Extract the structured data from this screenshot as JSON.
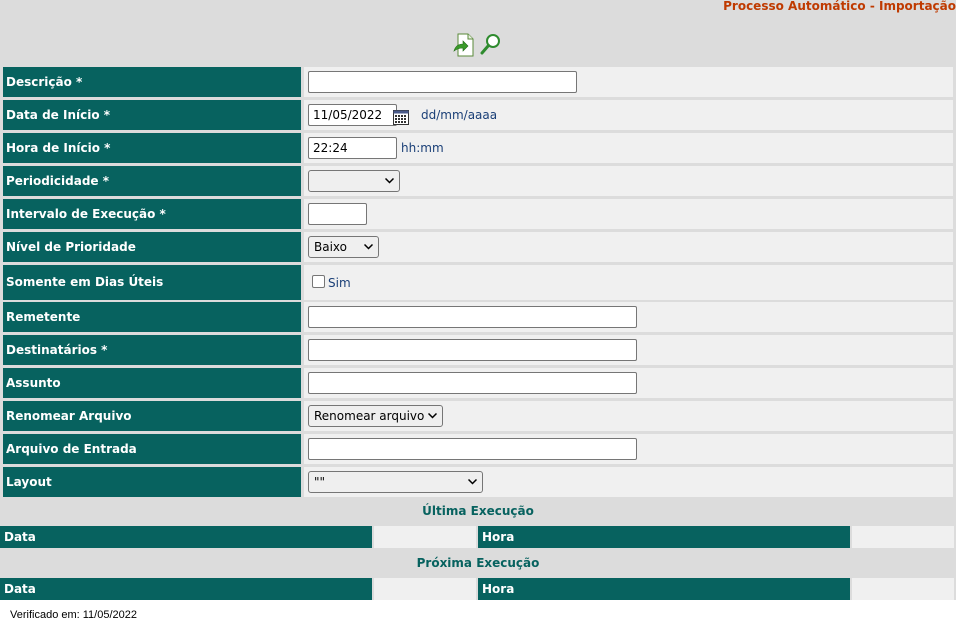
{
  "page_title": "Processo Automático - Importação",
  "toolbar": {
    "new_icon": "new-document-icon",
    "search_icon": "search-icon"
  },
  "form": {
    "descricao": {
      "label": "Descrição *",
      "value": ""
    },
    "data_inicio": {
      "label": "Data de Início *",
      "value": "11/05/2022",
      "hint": "dd/mm/aaaa"
    },
    "hora_inicio": {
      "label": "Hora de Início *",
      "value": "22:24",
      "hint": "hh:mm"
    },
    "periodicidade": {
      "label": "Periodicidade *",
      "selected": ""
    },
    "intervalo": {
      "label": "Intervalo de Execução *",
      "value": ""
    },
    "prioridade": {
      "label": "Nível de Prioridade",
      "selected": "Baixo"
    },
    "dias_uteis": {
      "label": "Somente em Dias Úteis",
      "checkbox_label": "Sim",
      "checked": false
    },
    "remetente": {
      "label": "Remetente",
      "value": ""
    },
    "destinatarios": {
      "label": "Destinatários *",
      "value": ""
    },
    "assunto": {
      "label": "Assunto",
      "value": ""
    },
    "renomear": {
      "label": "Renomear Arquivo",
      "selected": "Renomear arquivo"
    },
    "arquivo_entrada": {
      "label": "Arquivo de Entrada",
      "value": ""
    },
    "layout": {
      "label": "Layout",
      "selected": "\"\""
    }
  },
  "ultima_execucao": {
    "title": "Última Execução",
    "data_label": "Data",
    "hora_label": "Hora",
    "data_value": "",
    "hora_value": ""
  },
  "proxima_execucao": {
    "title": "Próxima Execução",
    "data_label": "Data",
    "hora_label": "Hora",
    "data_value": "",
    "hora_value": ""
  },
  "footer": {
    "verified": "Verificado em: 11/05/2022"
  },
  "colors": {
    "label_bg": "#07625f",
    "title": "#bf3a00",
    "hint": "#1a3f77",
    "field_bg": "#f0f0f0",
    "page_bg": "#dcdcdc"
  }
}
